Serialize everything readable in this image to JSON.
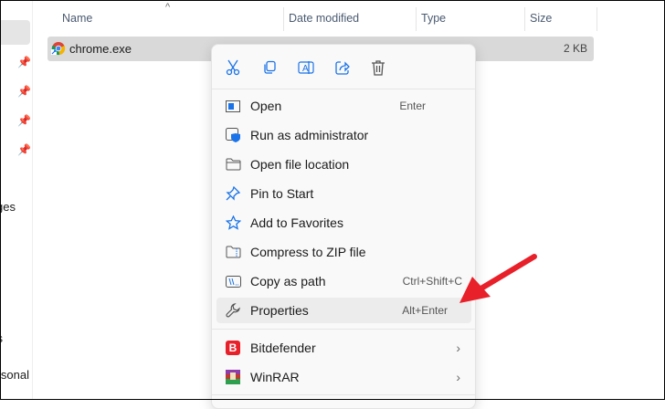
{
  "sidebar": {
    "partial_items": [
      "ges",
      "s",
      "rsonal"
    ]
  },
  "columns": {
    "name": "Name",
    "date": "Date modified",
    "type": "Type",
    "size": "Size"
  },
  "file": {
    "name": "chrome.exe",
    "size": "2 KB"
  },
  "toolbar": [
    "cut-icon",
    "copy-icon",
    "rename-icon",
    "share-icon",
    "delete-icon"
  ],
  "menu": {
    "items": [
      {
        "label": "Open",
        "shortcut": "Enter",
        "icon": "open-icon"
      },
      {
        "label": "Run as administrator",
        "shortcut": "",
        "icon": "shield-icon"
      },
      {
        "label": "Open file location",
        "shortcut": "",
        "icon": "folder-icon"
      },
      {
        "label": "Pin to Start",
        "shortcut": "",
        "icon": "pin-icon"
      },
      {
        "label": "Add to Favorites",
        "shortcut": "",
        "icon": "star-icon"
      },
      {
        "label": "Compress to ZIP file",
        "shortcut": "",
        "icon": "zip-icon"
      },
      {
        "label": "Copy as path",
        "shortcut": "Ctrl+Shift+C",
        "icon": "path-icon"
      },
      {
        "label": "Properties",
        "shortcut": "Alt+Enter",
        "icon": "wrench-icon"
      }
    ],
    "submenus": [
      {
        "label": "Bitdefender",
        "icon_letter": "B"
      },
      {
        "label": "WinRAR"
      }
    ]
  },
  "colors": {
    "accent": "#1a73e8",
    "arrow": "#e8202a",
    "bitdefender": "#e8202a"
  }
}
